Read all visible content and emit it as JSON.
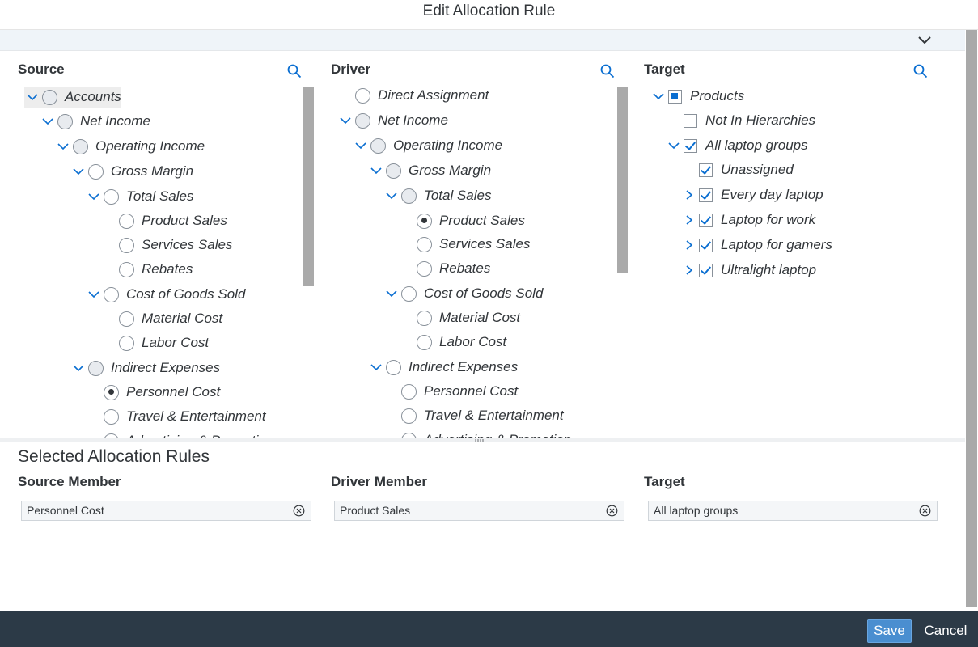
{
  "dialog": {
    "title": "Edit Allocation Rule"
  },
  "icons": {
    "expand": "chevron-down-icon",
    "collapse": "chevron-right-icon",
    "search": "search-icon",
    "remove": "close-circle-icon"
  },
  "source": {
    "header": "Source",
    "items": [
      {
        "label": "Accounts",
        "state": "partial",
        "expanded": true,
        "selected_row": true
      },
      {
        "label": "Net Income",
        "state": "partial",
        "expanded": true
      },
      {
        "label": "Operating Income",
        "state": "partial",
        "expanded": true
      },
      {
        "label": "Gross Margin",
        "state": "none",
        "expanded": true
      },
      {
        "label": "Total Sales",
        "state": "none",
        "expanded": true
      },
      {
        "label": "Product Sales",
        "state": "none"
      },
      {
        "label": "Services Sales",
        "state": "none"
      },
      {
        "label": "Rebates",
        "state": "none"
      },
      {
        "label": "Cost of Goods Sold",
        "state": "none",
        "expanded": true
      },
      {
        "label": "Material Cost",
        "state": "none"
      },
      {
        "label": "Labor Cost",
        "state": "none"
      },
      {
        "label": "Indirect Expenses",
        "state": "partial",
        "expanded": true
      },
      {
        "label": "Personnel Cost",
        "state": "on"
      },
      {
        "label": "Travel & Entertainment",
        "state": "none"
      },
      {
        "label": "Advertising & Promotion",
        "state": "none"
      }
    ]
  },
  "driver": {
    "header": "Driver",
    "items": [
      {
        "label": "Direct Assignment",
        "state": "none"
      },
      {
        "label": "Net Income",
        "state": "partial",
        "expanded": true
      },
      {
        "label": "Operating Income",
        "state": "partial",
        "expanded": true
      },
      {
        "label": "Gross Margin",
        "state": "partial",
        "expanded": true
      },
      {
        "label": "Total Sales",
        "state": "partial",
        "expanded": true
      },
      {
        "label": "Product Sales",
        "state": "on"
      },
      {
        "label": "Services Sales",
        "state": "none"
      },
      {
        "label": "Rebates",
        "state": "none"
      },
      {
        "label": "Cost of Goods Sold",
        "state": "none",
        "expanded": true
      },
      {
        "label": "Material Cost",
        "state": "none"
      },
      {
        "label": "Labor Cost",
        "state": "none"
      },
      {
        "label": "Indirect Expenses",
        "state": "none",
        "expanded": true
      },
      {
        "label": "Personnel Cost",
        "state": "none"
      },
      {
        "label": "Travel & Entertainment",
        "state": "none"
      },
      {
        "label": "Advertising & Promotion",
        "state": "none"
      }
    ]
  },
  "target": {
    "header": "Target",
    "items": [
      {
        "label": "Products",
        "state": "partial",
        "expanded": true
      },
      {
        "label": "Not In Hierarchies",
        "state": "unchecked"
      },
      {
        "label": "All laptop groups",
        "state": "checked",
        "expanded": true
      },
      {
        "label": "Unassigned",
        "state": "checked"
      },
      {
        "label": "Every day laptop",
        "state": "checked",
        "collapsed": true
      },
      {
        "label": "Laptop for work",
        "state": "checked",
        "collapsed": true
      },
      {
        "label": "Laptop for gamers",
        "state": "checked",
        "collapsed": true
      },
      {
        "label": "Ultralight laptop",
        "state": "checked",
        "collapsed": true
      }
    ]
  },
  "selected": {
    "title": "Selected Allocation Rules",
    "source_header": "Source Member",
    "driver_header": "Driver Member",
    "target_header": "Target",
    "source_value": "Personnel Cost",
    "driver_value": "Product Sales",
    "target_value": "All laptop groups"
  },
  "footer": {
    "save_label": "Save",
    "cancel_label": "Cancel"
  },
  "colors": {
    "accent": "#0a6ed1",
    "footer_bg": "#2c3a47",
    "save_bg": "#4a8ed0"
  }
}
